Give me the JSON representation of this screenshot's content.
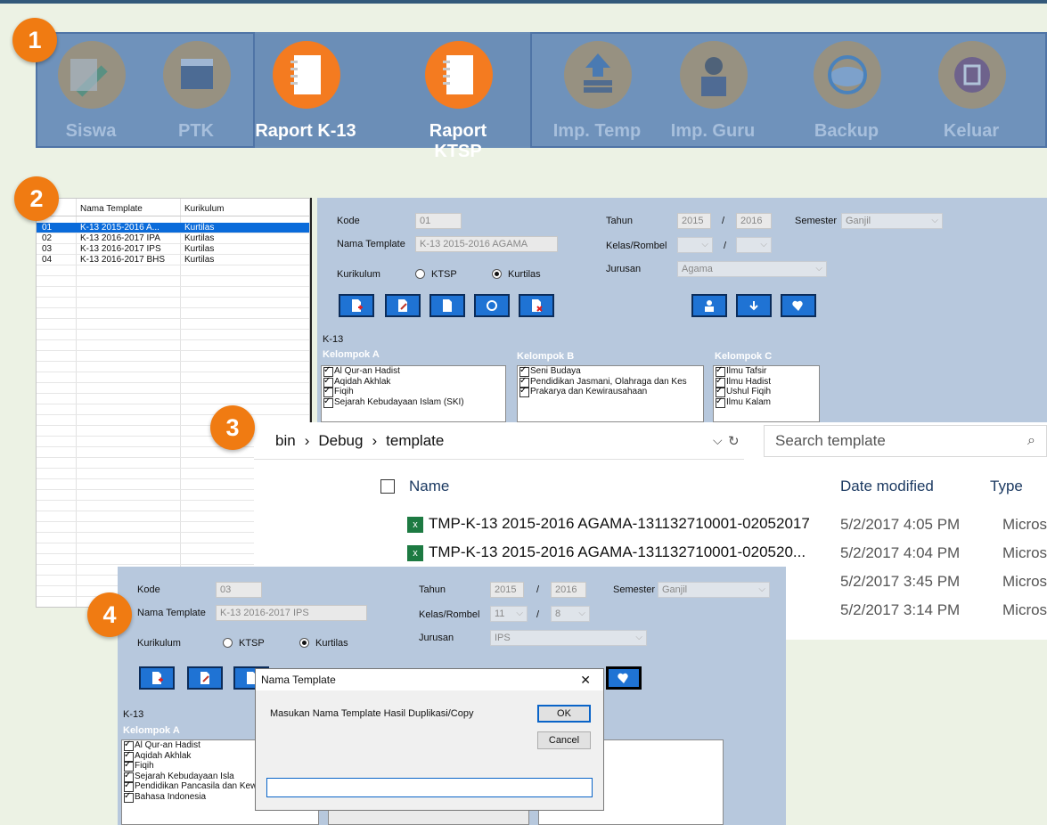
{
  "badges": [
    "1",
    "2",
    "3",
    "4"
  ],
  "toolbar": {
    "items": [
      {
        "label": "Siswa",
        "icon": "pencil-edit-icon"
      },
      {
        "label": "PTK",
        "icon": "calendar-icon"
      },
      {
        "label": "Raport K-13",
        "icon": "notebook-icon"
      },
      {
        "label": "Raport KTSP",
        "icon": "notebook-icon"
      },
      {
        "label": "Imp. Temp",
        "icon": "layers-upload-icon"
      },
      {
        "label": "Imp. Guru",
        "icon": "teacher-person-icon"
      },
      {
        "label": "Backup",
        "icon": "cloud-sync-icon"
      },
      {
        "label": "Keluar",
        "icon": "exit-door-icon"
      }
    ]
  },
  "grid": {
    "headers": [
      "Nama Template",
      "Kurikulum"
    ],
    "rows": [
      {
        "kode": "01",
        "nama": "K-13 2015-2016 A...",
        "kurikulum": "Kurtilas"
      },
      {
        "kode": "02",
        "nama": "K-13 2016-2017 IPA",
        "kurikulum": "Kurtilas"
      },
      {
        "kode": "03",
        "nama": "K-13 2016-2017 IPS",
        "kurikulum": "Kurtilas"
      },
      {
        "kode": "04",
        "nama": "K-13 2016-2017 BHS",
        "kurikulum": "Kurtilas"
      }
    ]
  },
  "form1": {
    "kode_label": "Kode",
    "kode_value": "01",
    "nama_label": "Nama Template",
    "nama_value": "K-13 2015-2016 AGAMA",
    "kurikulum_label": "Kurikulum",
    "ktsp": "KTSP",
    "kurtilas": "Kurtilas",
    "tahun_label": "Tahun",
    "tahun_start": "2015",
    "slash": "/",
    "tahun_end": "2016",
    "semester_label": "Semester",
    "semester_value": "Ganjil",
    "kelas_label": "Kelas/Rombel",
    "kelas_value": "",
    "rombel_value": "",
    "jurusan_label": "Jurusan",
    "jurusan_value": "Agama",
    "section": "K-13",
    "kelompok_a": "Kelompok A",
    "kelompok_b": "Kelompok B",
    "kelompok_c": "Kelompok C",
    "list_a": [
      "Al Qur-an Hadist",
      "Aqidah Akhlak",
      "Fiqih",
      "Sejarah Kebudayaan Islam (SKI)"
    ],
    "list_b": [
      "Seni Budaya",
      "Pendidikan Jasmani, Olahraga dan Kes",
      "Prakarya dan Kewirausahaan"
    ],
    "list_c": [
      "Ilmu Tafsir",
      "Ilmu Hadist",
      "Ushul Fiqih",
      "Ilmu Kalam"
    ]
  },
  "explorer": {
    "path": [
      "bin",
      "Debug",
      "template"
    ],
    "search_placeholder": "Search template",
    "col_name": "Name",
    "col_date": "Date modified",
    "col_type": "Type",
    "files": [
      {
        "name": "TMP-K-13 2015-2016 AGAMA-131132710001-02052017",
        "date": "5/2/2017 4:05 PM",
        "type": "Micros"
      },
      {
        "name": "TMP-K-13 2015-2016 AGAMA-131132710001-020520...",
        "date": "5/2/2017 4:04 PM",
        "type": "Micros"
      },
      {
        "name": "",
        "date": "5/2/2017 3:45 PM",
        "type": "Micros"
      },
      {
        "name": "",
        "date": "5/2/2017 3:14 PM",
        "type": "Micros"
      }
    ]
  },
  "form2": {
    "kode_label": "Kode",
    "kode_value": "03",
    "nama_label": "Nama Template",
    "nama_value": "K-13 2016-2017 IPS",
    "kurikulum_label": "Kurikulum",
    "ktsp": "KTSP",
    "kurtilas": "Kurtilas",
    "tahun_label": "Tahun",
    "tahun_start": "2015",
    "slash": "/",
    "tahun_end": "2016",
    "semester_label": "Semester",
    "semester_value": "Ganjil",
    "kelas_label": "Kelas/Rombel",
    "kelas_value": "11",
    "rombel_value": "8",
    "jurusan_label": "Jurusan",
    "jurusan_value": "IPS",
    "section": "K-13",
    "kelompok_a": "Kelompok A",
    "list_a": [
      "Al Qur-an Hadist",
      "Aqidah Akhlak",
      "Fiqih",
      "Sejarah Kebudayaan Isla",
      "Pendidikan Pancasila dan Kewarganeg",
      "Bahasa Indonesia"
    ]
  },
  "dialog": {
    "title": "Nama Template",
    "close": "✕",
    "prompt": "Masukan Nama Template Hasil Duplikasi/Copy",
    "ok": "OK",
    "cancel": "Cancel",
    "input_value": ""
  },
  "colors": {
    "accent": "#f07b12",
    "toolbar": "#6b8eb7",
    "form": "#b7c8dd",
    "button": "#1f73d4",
    "selection": "#0a6bda"
  }
}
